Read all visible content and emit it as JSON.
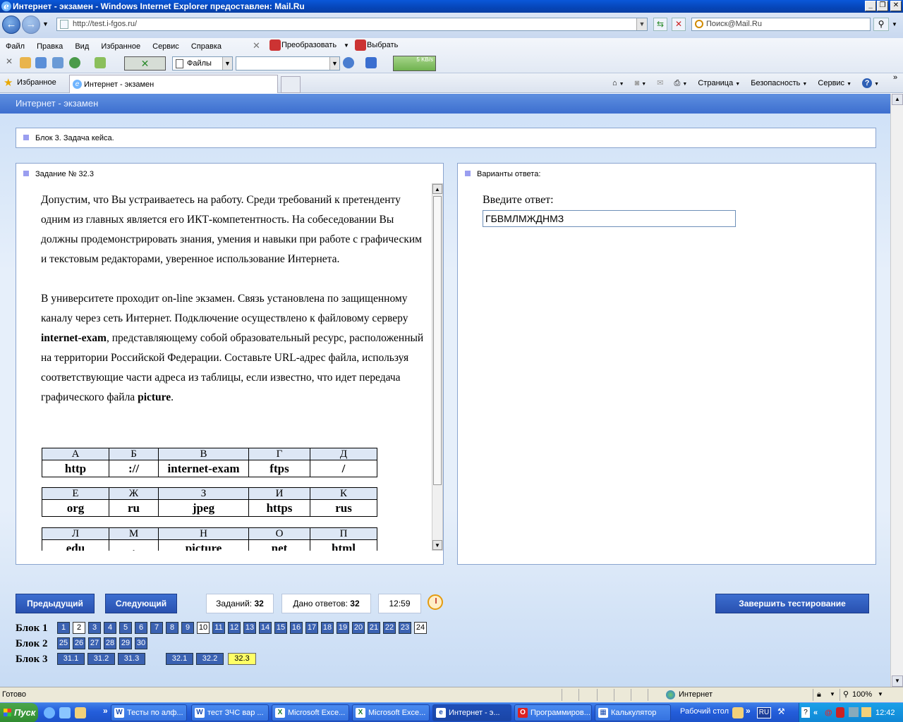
{
  "window": {
    "title": "Интернет - экзамен - Windows Internet Explorer предоставлен: Mail.Ru"
  },
  "address": {
    "url": "http://test.i-fgos.ru/"
  },
  "search": {
    "placeholder": "Поиск@Mail.Ru"
  },
  "menu": [
    "Файл",
    "Правка",
    "Вид",
    "Избранное",
    "Сервис",
    "Справка"
  ],
  "toolbar": {
    "convert": "Преобразовать",
    "select": "Выбрать",
    "files": "Файлы",
    "speed": "5 KB/s"
  },
  "favorites": {
    "label": "Избранное",
    "tab": "Интернет - экзамен"
  },
  "commandbar": {
    "page": "Страница",
    "safety": "Безопасность",
    "tools": "Сервис"
  },
  "page": {
    "header": "Интернет - экзамен"
  },
  "block": {
    "title": "Блок 3. Задача кейса."
  },
  "task": {
    "title": "Задание № 32.3",
    "para1": "Допустим, что Вы устраиваетесь на работу. Среди требований к претенденту одним из главных является его ИКТ-компетентность. На собеседовании Вы должны продемонстрировать знания, умения и навыки при работе с графическим и текстовым редакторами, уверенное использование Интернета.",
    "para2_a": "В университете проходит on-line экзамен. Связь установлена по защищенному каналу через сеть Интернет. Подключение осуществлено к файловому серверу ",
    "para2_b": "internet-exam",
    "para2_c": ", представляющему собой образовательный ресурс, расположенный на территории Российской Федерации. Составьте URL-адрес файла, используя соответствующие части адреса из таблицы, если известно, что идет передача графического файла ",
    "para2_d": "picture",
    "para2_e": ".",
    "tables": [
      {
        "letters": [
          "А",
          "Б",
          "В",
          "Г",
          "Д"
        ],
        "values": [
          "http",
          "://",
          "internet-exam",
          "ftps",
          "/"
        ]
      },
      {
        "letters": [
          "Е",
          "Ж",
          "З",
          "И",
          "К"
        ],
        "values": [
          "org",
          "ru",
          "jpeg",
          "https",
          "rus"
        ]
      },
      {
        "letters": [
          "Л",
          "М",
          "Н",
          "О",
          "П"
        ],
        "values": [
          "edu",
          ".",
          "picture",
          "net",
          "html"
        ]
      }
    ]
  },
  "answers": {
    "title": "Варианты ответа:",
    "prompt": "Введите ответ:",
    "value": "ГБВМЛМЖДНМЗ"
  },
  "nav": {
    "prev": "Предыдущий",
    "next": "Следующий",
    "finish": "Завершить тестирование",
    "tasks_label": "Заданий:",
    "tasks_count": "32",
    "answered_label": "Дано ответов:",
    "answered_count": "32",
    "timer": "12:59"
  },
  "blocks": [
    {
      "label": "Блок 1",
      "items": [
        "1",
        "2",
        "3",
        "4",
        "5",
        "6",
        "7",
        "8",
        "9",
        "10",
        "11",
        "12",
        "13",
        "14",
        "15",
        "16",
        "17",
        "18",
        "19",
        "20",
        "21",
        "22",
        "23",
        "24"
      ],
      "white": [
        "2",
        "10",
        "24"
      ]
    },
    {
      "label": "Блок 2",
      "items": [
        "25",
        "26",
        "27",
        "28",
        "29",
        "30"
      ],
      "white": []
    },
    {
      "label": "Блок 3",
      "items": [
        "31.1",
        "31.2",
        "31.3",
        "32.1",
        "32.2",
        "32.3"
      ],
      "white": [],
      "current": "32.3"
    }
  ],
  "status": {
    "left": "Готово",
    "zone": "Интернет",
    "zoom": "100%"
  },
  "taskbar": {
    "start": "Пуск",
    "items": [
      "Тесты по алф...",
      "тест ЗЧС вар ...",
      "Microsoft Exce...",
      "Microsoft Exce...",
      "Интернет - э...",
      "Программиров...",
      "Калькулятор"
    ],
    "desktop": "Рабочий стол",
    "lang": "RU",
    "clock": "12:42"
  },
  "colors": {
    "accent": "#3d6fcf",
    "button": "#2951b0",
    "current_task": "#ffff66"
  }
}
